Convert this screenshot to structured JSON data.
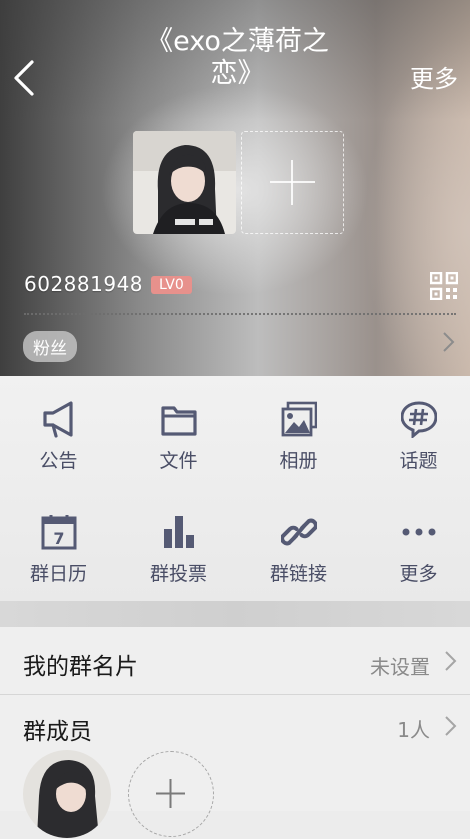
{
  "header": {
    "title": "《exo之薄荷之恋》",
    "more_label": "更多",
    "group_id": "602881948",
    "level_badge": "LV0",
    "fans_tag": "粉丝"
  },
  "functions": [
    {
      "label": "公告",
      "icon": "megaphone-icon"
    },
    {
      "label": "文件",
      "icon": "folder-icon"
    },
    {
      "label": "相册",
      "icon": "album-icon"
    },
    {
      "label": "话题",
      "icon": "topic-icon"
    },
    {
      "label": "群日历",
      "icon": "calendar-icon"
    },
    {
      "label": "群投票",
      "icon": "vote-icon"
    },
    {
      "label": "群链接",
      "icon": "link-icon"
    },
    {
      "label": "更多",
      "icon": "more-dots-icon"
    }
  ],
  "calendar_day": "7",
  "card_row": {
    "label": "我的群名片",
    "value": "未设置"
  },
  "members_row": {
    "label": "群成员",
    "count": "1人"
  },
  "colors": {
    "icon": "#555a74",
    "badge": "#e7918c",
    "text_dark": "#1a1a1a",
    "text_muted": "#8a8a8a"
  }
}
